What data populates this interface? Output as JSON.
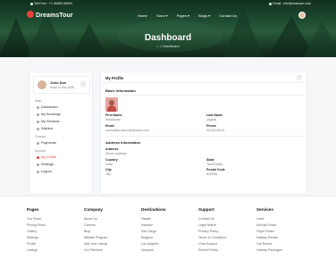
{
  "topbar": {
    "phone": "Toll Free : +1 56565 56594",
    "email": "Email : info@example.com"
  },
  "nav": {
    "logo": "DreamsTour",
    "menu": [
      "Home",
      "Tours",
      "Pages",
      "Blogs",
      "Contact Us"
    ]
  },
  "hero": {
    "title": "Dashboard",
    "breadcrumb_home": "⌂",
    "breadcrumb_sep": ">",
    "breadcrumb_current": "Dashboard"
  },
  "sidebar": {
    "name": "John Doe",
    "since": "Since 10 Sep 2025",
    "main_label": "Main",
    "main_items": [
      "Dashboard",
      "My Bookings",
      "My Reviews",
      "Wishlist"
    ],
    "finance_label": "Finance",
    "finance_items": [
      "Payments"
    ],
    "account_label": "Account",
    "account_items": [
      "My Profile",
      "Settings",
      "Logout"
    ]
  },
  "profile": {
    "title": "My Profile",
    "basic_title": "Basic Information",
    "first_name_label": "First Name",
    "first_name": "Raudonae",
    "last_name_label": "Last Name",
    "last_name": "Jayjoej",
    "email_label": "Email",
    "email": "coolunited.demo@demort.com",
    "phone_label": "Phone",
    "phone": "9215416314",
    "address_title": "Address Information",
    "address_label": "Address",
    "address": "Street address",
    "country_label": "Country",
    "country": "India",
    "state_label": "State",
    "state": "Tamil Nadu",
    "city_label": "City",
    "city": "Jilly",
    "postal_label": "Postal Code",
    "postal": "620938"
  },
  "footer": {
    "columns": [
      {
        "title": "Pages",
        "links": [
          "Our Team",
          "Pricing Plans",
          "Gallery",
          "Settings",
          "Profile",
          "Listings"
        ]
      },
      {
        "title": "Company",
        "links": [
          "About Us",
          "Careers",
          "Blog",
          "Affiliate Program",
          "Add Your Listing",
          "Our Partners"
        ]
      },
      {
        "title": "Destinations",
        "links": [
          "Hawaii",
          "Istanbul",
          "San Diego",
          "Belgium",
          "Los Angeles",
          "Newyork"
        ]
      },
      {
        "title": "Support",
        "links": [
          "Contact Us",
          "Legal Notice",
          "Privacy Policy",
          "Terms & Conditions",
          "Chat Support",
          "Refund Policy"
        ]
      },
      {
        "title": "Services",
        "links": [
          "Hotel",
          "Activity Finder",
          "Flight Finder",
          "Holiday Rental",
          "Car Rental",
          "Holiday Packages"
        ]
      }
    ]
  },
  "colors": {
    "accent": "#e8423b",
    "hero_dark": "#12301f"
  }
}
